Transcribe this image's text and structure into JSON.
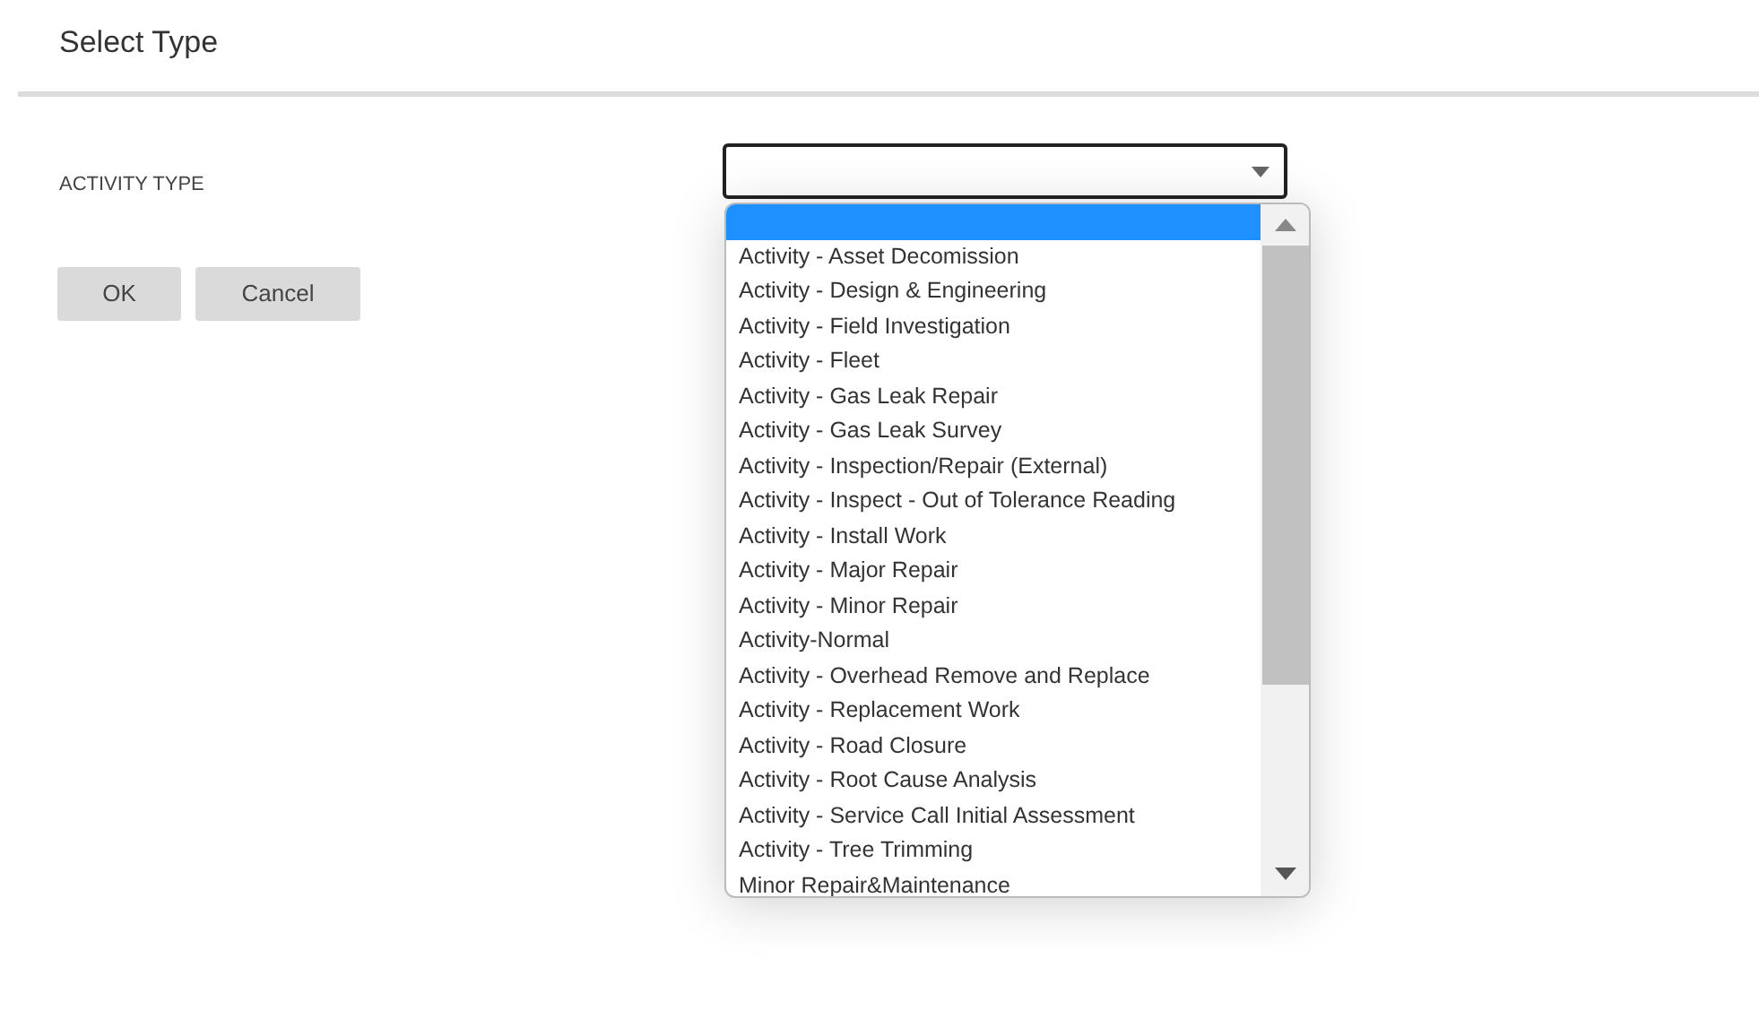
{
  "dialog": {
    "title": "Select Type"
  },
  "field": {
    "label": "ACTIVITY TYPE",
    "expanded": true
  },
  "options": [
    {
      "selected": true
    },
    {
      "label": "Activity - Asset Decomission",
      "selected": false
    },
    {
      "label": "Activity - Design & Engineering",
      "selected": false
    },
    {
      "label": "Activity - Field Investigation",
      "selected": false
    },
    {
      "label": "Activity - Fleet",
      "selected": false
    },
    {
      "label": "Activity - Gas Leak Repair",
      "selected": false
    },
    {
      "label": "Activity - Gas Leak Survey",
      "selected": false
    },
    {
      "label": "Activity - Inspection/Repair (External)",
      "selected": false
    },
    {
      "label": "Activity - Inspect - Out of Tolerance Reading",
      "selected": false
    },
    {
      "label": "Activity - Install Work",
      "selected": false
    },
    {
      "label": "Activity - Major Repair",
      "selected": false
    },
    {
      "label": "Activity - Minor Repair",
      "selected": false
    },
    {
      "label": "Activity-Normal",
      "selected": false
    },
    {
      "label": "Activity - Overhead Remove and Replace",
      "selected": false
    },
    {
      "label": "Activity - Replacement Work",
      "selected": false
    },
    {
      "label": "Activity - Road Closure",
      "selected": false
    },
    {
      "label": "Activity - Root Cause Analysis",
      "selected": false
    },
    {
      "label": "Activity - Service Call Initial Assessment",
      "selected": false
    },
    {
      "label": "Activity - Tree Trimming",
      "selected": false
    },
    {
      "label": "Minor Repair&Maintenance",
      "selected": false
    }
  ],
  "buttons": [
    "OK",
    "Cancel"
  ]
}
